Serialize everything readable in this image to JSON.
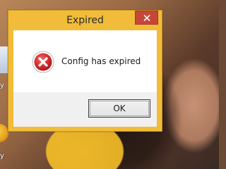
{
  "window": {
    "title": "Expired",
    "close_icon": "close-icon",
    "accent_color": "#f0bc3a",
    "close_color": "#c7463c"
  },
  "message": {
    "icon": "error-icon",
    "text": "Config has expired"
  },
  "buttons": {
    "ok_label": "OK"
  },
  "desktop": {
    "icons": [
      {
        "icon": "document-icon",
        "label": "y"
      },
      {
        "icon": "app-icon",
        "label": "y"
      }
    ]
  }
}
